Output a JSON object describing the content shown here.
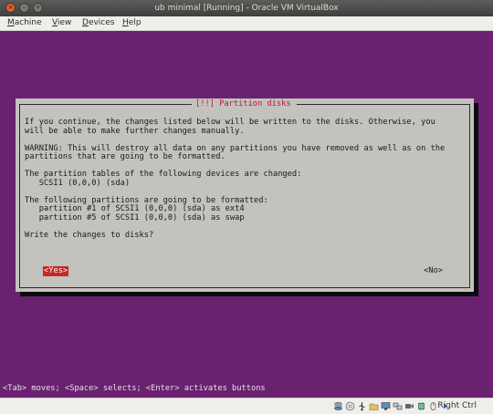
{
  "window": {
    "title": "ub minimal [Running] - Oracle VM VirtualBox",
    "controls": [
      "×",
      "–",
      "+"
    ]
  },
  "menubar": {
    "items": [
      "Machine",
      "View",
      "Devices",
      "Help"
    ]
  },
  "dialog": {
    "title": "[!!] Partition disks",
    "lines": [
      "If you continue, the changes listed below will be written to the disks. Otherwise, you",
      "will be able to make further changes manually.",
      "",
      "WARNING: This will destroy all data on any partitions you have removed as well as on the",
      "partitions that are going to be formatted.",
      "",
      "The partition tables of the following devices are changed:",
      "   SCSI1 (0,0,0) (sda)",
      "",
      "The following partitions are going to be formatted:",
      "   partition #1 of SCSI1 (0,0,0) (sda) as ext4",
      "   partition #5 of SCSI1 (0,0,0) (sda) as swap",
      "",
      "Write the changes to disks?"
    ],
    "yes_label": "<Yes>",
    "no_label": "<No>"
  },
  "help_line": "<Tab> moves; <Space> selects; <Enter> activates buttons",
  "statusbar": {
    "host_key": "Right Ctrl",
    "icons": [
      "hard-disk-icon",
      "optical-drive-icon",
      "usb-icon",
      "shared-folders-icon",
      "display-icon",
      "network-icon",
      "recording-icon",
      "cpu-icon",
      "mouse-integration-icon",
      "keyboard-icon"
    ]
  },
  "colors": {
    "screen_bg": "#6a2170",
    "dialog_bg": "#c3c2bf",
    "dialog_title": "#b5202a",
    "selected_button": "#c42924"
  }
}
